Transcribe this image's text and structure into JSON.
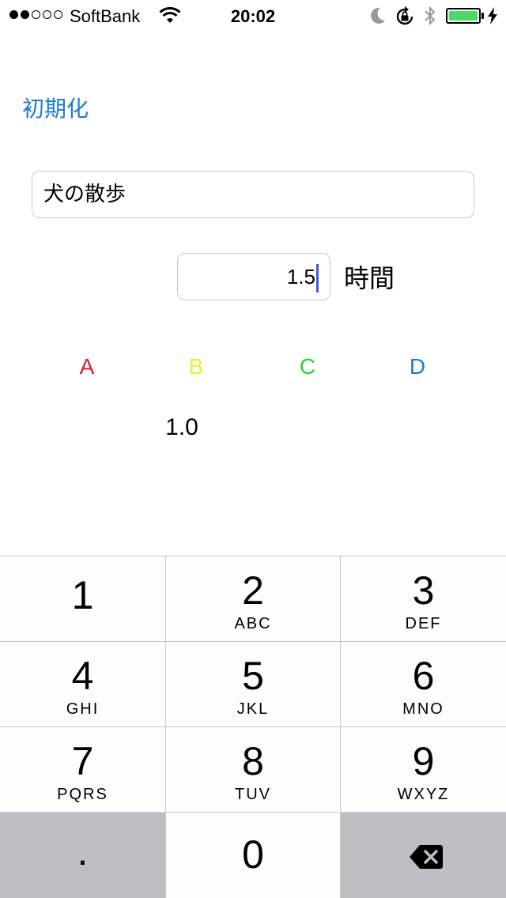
{
  "status_bar": {
    "carrier": "SoftBank",
    "time": "20:02",
    "signal_bars_filled": 2,
    "signal_bars_total": 5,
    "battery_color": "#4cd964"
  },
  "toolbar": {
    "reset_label": "初期化"
  },
  "form": {
    "title_value": "犬の散歩",
    "hours_value": "1.5",
    "hours_unit": "時間"
  },
  "labels": {
    "a": "A",
    "b": "B",
    "c": "C",
    "d": "D",
    "b_value": "1.0"
  },
  "colors": {
    "accent": "#1a7bd1",
    "label_a": "#d0202a",
    "label_b": "#f2ea2a",
    "label_c": "#2ad62a",
    "label_d": "#1a7bd1"
  },
  "keypad": {
    "keys": [
      {
        "digit": "1",
        "letters": ""
      },
      {
        "digit": "2",
        "letters": "ABC"
      },
      {
        "digit": "3",
        "letters": "DEF"
      },
      {
        "digit": "4",
        "letters": "GHI"
      },
      {
        "digit": "5",
        "letters": "JKL"
      },
      {
        "digit": "6",
        "letters": "MNO"
      },
      {
        "digit": "7",
        "letters": "PQRS"
      },
      {
        "digit": "8",
        "letters": "TUV"
      },
      {
        "digit": "9",
        "letters": "WXYZ"
      }
    ],
    "decimal": ".",
    "zero": "0",
    "backspace_icon": "backspace-icon"
  }
}
